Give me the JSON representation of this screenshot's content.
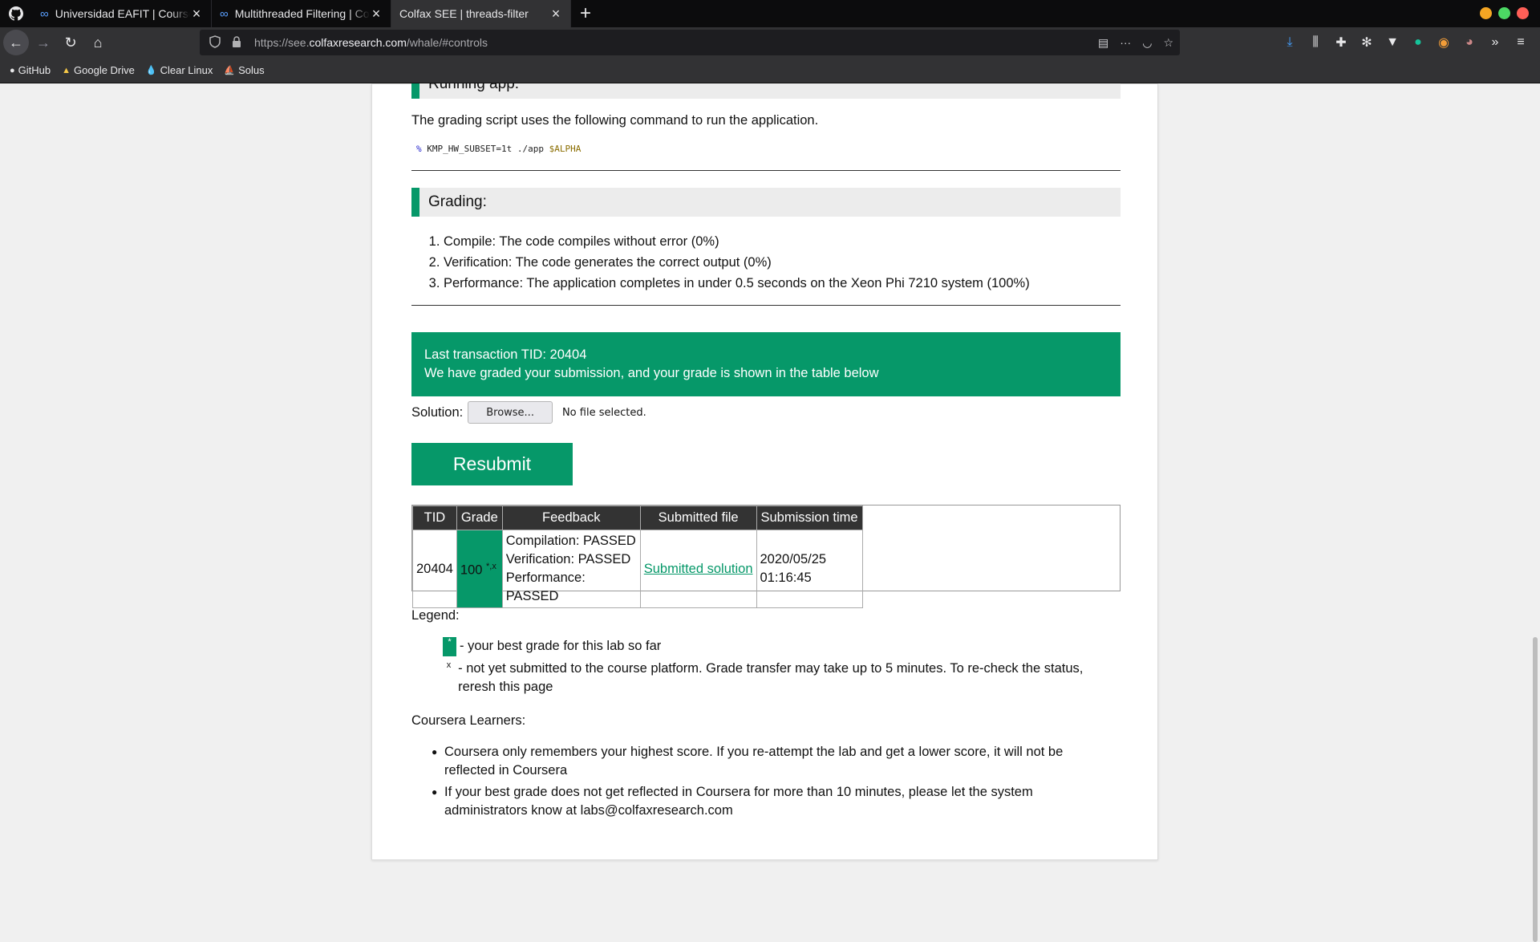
{
  "tabs": [
    {
      "label": "Universidad EAFIT | Coursera",
      "active": false
    },
    {
      "label": "Multithreaded Filtering | Coursera",
      "active": false
    },
    {
      "label": "Colfax SEE | threads-filter",
      "active": true
    }
  ],
  "nav": {
    "url_prefix": "https://see.",
    "url_domain": "colfaxresearch.com",
    "url_path": "/whale/#controls"
  },
  "bookmarks": [
    {
      "label": "GitHub",
      "icon": "github-icon"
    },
    {
      "label": "Google Drive",
      "icon": "drive-icon"
    },
    {
      "label": "Clear Linux",
      "icon": "clearlinux-icon"
    },
    {
      "label": "Solus",
      "icon": "solus-icon"
    }
  ],
  "page": {
    "running_header": "Running app:",
    "run_text": "The grading script uses the following command to run the application.",
    "code_prompt": "%",
    "code_cmd": "KMP_HW_SUBSET=1t ./app",
    "code_var": "$ALPHA",
    "grading_header": "Grading:",
    "grading_items": [
      "Compile: The code compiles without error (0%)",
      "Verification: The code generates the correct output (0%)",
      "Performance: The application completes in under 0.5 seconds on the Xeon Phi 7210 system (100%)"
    ],
    "notice_line1": "Last transaction TID: 20404",
    "notice_line2": "We have graded your submission, and your grade is shown in the table below",
    "solution_label": "Solution:",
    "browse_label": "Browse...",
    "nofile_label": "No file selected.",
    "resubmit_label": "Resubmit",
    "table": {
      "headers": [
        "TID",
        "Grade",
        "Feedback",
        "Submitted file",
        "Submission time"
      ],
      "row": {
        "tid": "20404",
        "grade": "100",
        "grade_marks": "*,x",
        "feedback": [
          "Compilation: PASSED",
          "Verification: PASSED",
          "Performance: PASSED"
        ],
        "file_link": "Submitted solution",
        "date": "2020/05/25",
        "time": "01:16:45"
      }
    },
    "legend_title": "Legend:",
    "legend_star_mark": "*",
    "legend_star_text": "- your best grade for this lab so far",
    "legend_x_mark": "x",
    "legend_x_text": "- not yet submitted to the course platform. Grade transfer may take up to 5 minutes. To re-check the status, reresh this page",
    "coursera_title": "Coursera Learners:",
    "coursera_items": [
      "Coursera only remembers your highest score. If you re-attempt the lab and get a lower score, it will not be reflected in Coursera",
      "If your best grade does not get reflected in Coursera for more than 10 minutes, please let the system administrators know at labs@colfaxresearch.com"
    ]
  },
  "colors": {
    "accent": "#069869",
    "header_dark": "#333333",
    "chrome": "#0c0c0d"
  }
}
